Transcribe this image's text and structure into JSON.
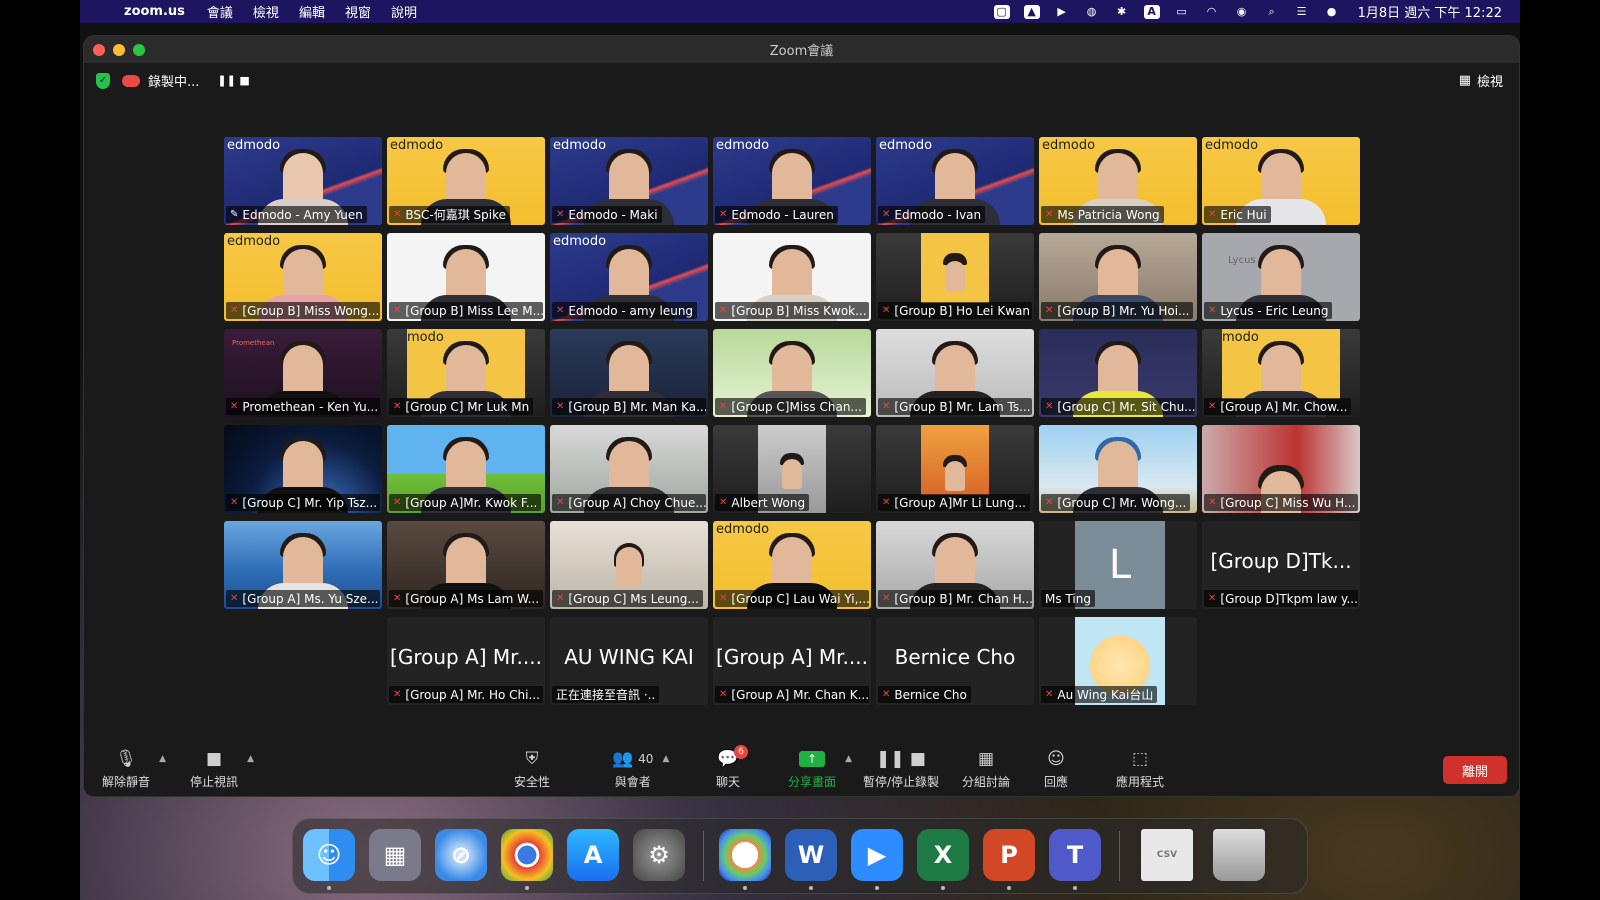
{
  "menubar": {
    "app_name": "zoom.us",
    "menus": [
      "會議",
      "檢視",
      "編輯",
      "視窗",
      "說明"
    ],
    "clock": "1月8日 週六 下午 12:22"
  },
  "window": {
    "title": "Zoom會議"
  },
  "infobar": {
    "recording_label": "錄製中...",
    "view_label": "檢視"
  },
  "gallery": {
    "participants": [
      "Edmodo - Amy Yuen",
      "BSC-何嘉琪 Spike",
      "Edmodo - Maki",
      "Edmodo - Lauren",
      "Edmodo - Ivan",
      "Ms Patricia Wong",
      "Eric Hui",
      "[Group B] Miss Wong...",
      "[Group B] Miss Lee M...",
      "Edmodo - amy leung",
      "[Group B] Miss Kwok...",
      "[Group B] Ho Lei Kwan",
      "[Group B] Mr. Yu Hoi...",
      "Lycus - Eric Leung",
      "Promethean - Ken Yu...",
      "[Group C] Mr Luk Mn",
      "[Group B] Mr. Man Ka...",
      "[Group C]Miss Chan...",
      "[Group B] Mr. Lam Ts...",
      "[Group C] Mr. Sit Chu...",
      "[Group A] Mr. Chow...",
      "[Group C] Mr. Yip Tsz...",
      "[Group A]Mr. Kwok F...",
      "[Group A] Choy Chue...",
      "Albert Wong",
      "[Group A]Mr Li Lung...",
      "[Group C] Mr. Wong...",
      "[Group C] Miss Wu H...",
      "[Group A] Ms. Yu Sze...",
      "[Group A] Ms Lam W...",
      "[Group C] Ms Leung...",
      "[Group C] Lau Wai Yi,...",
      "[Group B] Mr. Chan H...",
      "Ms Ting",
      "[Group D]Tkpm law y...",
      "[Group A] Mr. Ho Chi...",
      "正在連接至音訊 ·..",
      "[Group A] Mr. Chan K...",
      "Bernice Cho",
      "Au Wing Kai台山"
    ],
    "center_names": {
      "group_d": "[Group D]Tk...",
      "ho_chi": "[Group A] Mr....",
      "au_wing_kai": "AU WING KAI",
      "chan_k": "[Group A] Mr....",
      "bernice": "Bernice Cho"
    },
    "letter_avatar": "L",
    "brand_text": "edmodo",
    "brand_text_cut": "modo",
    "brand_text_lycus": "Lycus Soluti",
    "brand_text_promethean": "Promethean"
  },
  "toolbar": {
    "unmute": "解除靜音",
    "stop_video": "停止視訊",
    "security": "安全性",
    "participants": "與會者",
    "participants_count": "40",
    "chat": "聊天",
    "chat_badge": "6",
    "share": "分享畫面",
    "record": "暫停/停止錄製",
    "breakout": "分組討論",
    "reactions": "回應",
    "apps": "應用程式",
    "leave": "離開"
  },
  "dock": {
    "apps": [
      "Finder",
      "Launchpad",
      "Safari",
      "Chrome",
      "App Store",
      "System Preferences",
      "Creative Cloud",
      "Word",
      "Zoom",
      "Excel",
      "PowerPoint",
      "Teams",
      "CSV",
      "Trash"
    ]
  },
  "colors": {
    "menubar": "#1d1560",
    "leave": "#d0312d",
    "share": "#1fb141",
    "active_speaker": "#34c759",
    "muted": "#e8453c"
  }
}
